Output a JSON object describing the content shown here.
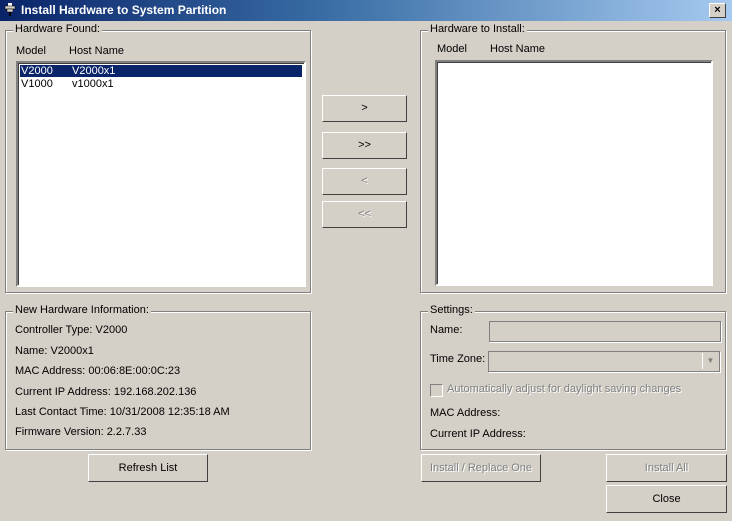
{
  "window": {
    "title": "Install Hardware to System Partition",
    "close_glyph": "×"
  },
  "hardware_found": {
    "label": "Hardware Found:",
    "columns": [
      "Model",
      "Host Name"
    ],
    "rows": [
      {
        "model": "V2000",
        "host": "V2000x1",
        "selected": true
      },
      {
        "model": "V1000",
        "host": "v1000x1",
        "selected": false
      }
    ]
  },
  "hardware_to_install": {
    "label": "Hardware to Install:",
    "columns": [
      "Model",
      "Host Name"
    ],
    "rows": []
  },
  "transfer_buttons": {
    "add_one": ">",
    "add_all": ">>",
    "remove_one": "<",
    "remove_all": "<<"
  },
  "new_hardware_info": {
    "label": "New Hardware Information:",
    "controller_type": "Controller Type: V2000",
    "name": "Name: V2000x1",
    "mac": "MAC Address: 00:06:8E:00:0C:23",
    "ip": "Current IP Address: 192.168.202.136",
    "last_contact": "Last Contact Time: 10/31/2008 12:35:18 AM",
    "firmware": "Firmware Version: 2.2.7.33"
  },
  "settings": {
    "label": "Settings:",
    "name_label": "Name:",
    "name_value": "",
    "timezone_label": "Time Zone:",
    "timezone_value": "",
    "dst_label": "Automatically adjust for daylight saving changes",
    "dst_checked": false,
    "mac_label": "MAC Address:",
    "ip_label": "Current IP Address:"
  },
  "buttons": {
    "refresh": "Refresh List",
    "install_replace": "Install / Replace One",
    "install_all": "Install All",
    "close": "Close"
  }
}
